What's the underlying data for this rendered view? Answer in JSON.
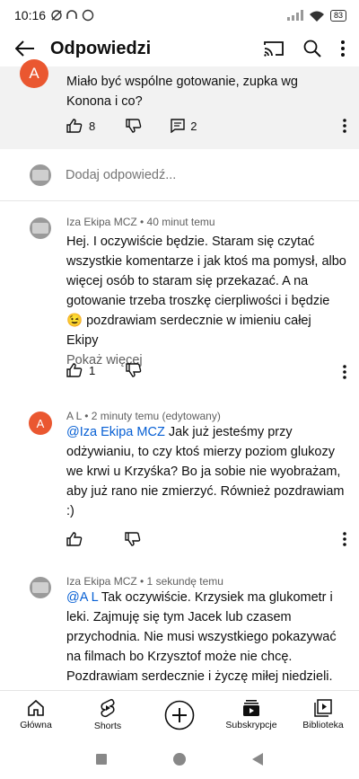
{
  "status": {
    "time": "10:16",
    "battery": "83"
  },
  "app_bar": {
    "title": "Odpowiedzi"
  },
  "parent_comment": {
    "avatar_letter": "A",
    "text": "Miało być wspólne gotowanie, zupka wg Konona i co?",
    "likes": "8",
    "replies": "2"
  },
  "reply_box": {
    "placeholder": "Dodaj odpowiedź..."
  },
  "comments": [
    {
      "meta": "Iza Ekipa MCZ • 40 minut temu",
      "text": "Hej. I oczywiście będzie. Staram się czytać wszystkie komentarze i jak ktoś ma pomysł, albo więcej osób to staram się przekazać. A na gotowanie trzeba troszkę cierpliwości i będzie 😉 pozdrawiam serdecznie w imieniu całej Ekipy",
      "show_more": "Pokaż więcej",
      "likes": "1"
    },
    {
      "avatar_letter": "A",
      "meta": "A L • 2 minuty temu (edytowany)",
      "mention": "@Iza Ekipa MCZ",
      "text": " Jak już jesteśmy przy odżywianiu, to czy ktoś mierzy poziom glukozy we krwi u Krzyśka? Bo ja sobie nie wyobrażam, aby już rano nie zmierzyć. Również pozdrawiam :)"
    },
    {
      "meta": "Iza Ekipa MCZ • 1 sekundę temu",
      "mention": "@A L",
      "text": " Tak oczywiście. Krzysiek ma glukometr i leki. Zajmuję się tym Jacek lub czasem przychodnia. Nie musi wszystkiego pokazywać na filmach bo Krzysztof może nie chcę. Pozdrawiam serdecznie i życzę miłej niedzieli."
    }
  ],
  "bottom_nav": [
    {
      "label": "Główna"
    },
    {
      "label": "Shorts"
    },
    {
      "label": ""
    },
    {
      "label": "Subskrypcje"
    },
    {
      "label": "Biblioteka"
    }
  ]
}
